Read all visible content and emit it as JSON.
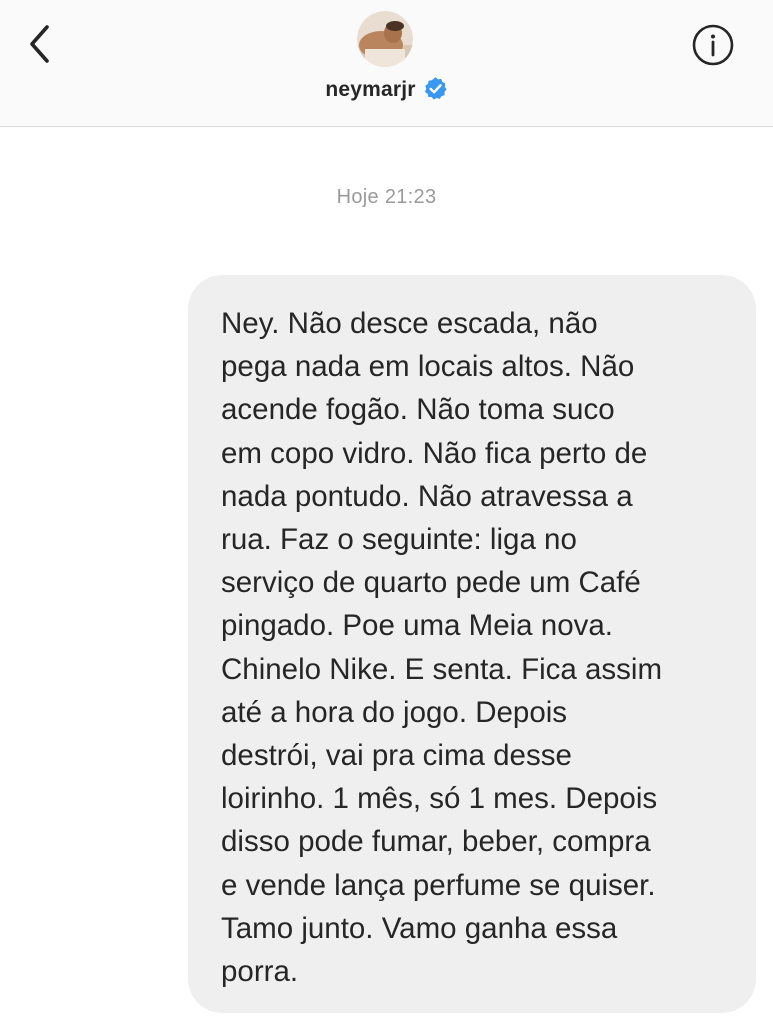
{
  "header": {
    "back_icon": "chevron-left-icon",
    "avatar_icon": "profile-avatar",
    "username": "neymarjr",
    "verified_icon": "verified-badge-icon",
    "info_icon": "info-icon"
  },
  "thread": {
    "timestamp": "Hoje 21:23",
    "messages": [
      {
        "direction": "outgoing",
        "text": "Ney. Não desce escada, não\npega nada em locais altos. Não\nacende fogão. Não toma suco\nem copo vidro. Não fica perto de\nnada pontudo. Não atravessa a\nrua. Faz o seguinte: liga no\nserviço de quarto pede um Café\npingado. Poe uma Meia nova.\nChinelo Nike. E senta. Fica assim\naté a hora do jogo. Depois\ndestrói, vai pra cima desse\nloirinho. 1 mês, só 1 mes. Depois\ndisso pode fumar, beber, compra\ne vende lança perfume se quiser.\nTamo junto. Vamo ganha essa\nporra."
      }
    ]
  },
  "colors": {
    "header_bg": "#fafafa",
    "bubble_bg": "#efefef",
    "text": "#262626",
    "timestamp": "#9a9a9a",
    "verified": "#3897f0"
  }
}
